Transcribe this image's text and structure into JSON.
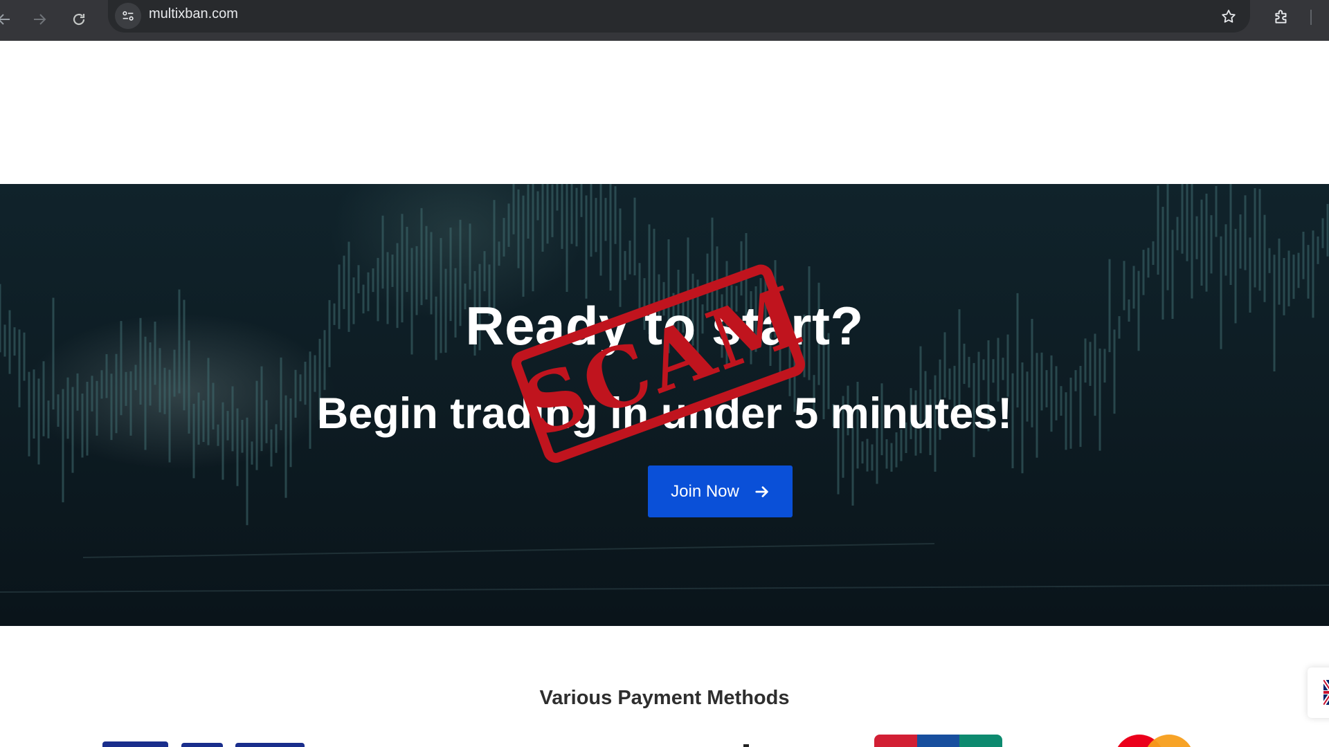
{
  "browser": {
    "url": "multixban.com",
    "icons": [
      "back-arrow-icon",
      "forward-arrow-icon",
      "reload-icon",
      "site-settings-icon",
      "star-icon",
      "extensions-icon"
    ]
  },
  "hero": {
    "title": "Ready to start?",
    "subtitle": "Begin trading in under 5 minutes!",
    "cta_label": "Join Now",
    "stamp_text": "SCAM",
    "stamp_color": "#c0141e",
    "button_color": "#0a50d8"
  },
  "payment": {
    "heading": "Various Payment Methods",
    "logos": [
      "pix-logo",
      "logo",
      "jcb-logo",
      "mastercard-logo"
    ]
  },
  "language": {
    "flag": "uk-flag-icon"
  }
}
